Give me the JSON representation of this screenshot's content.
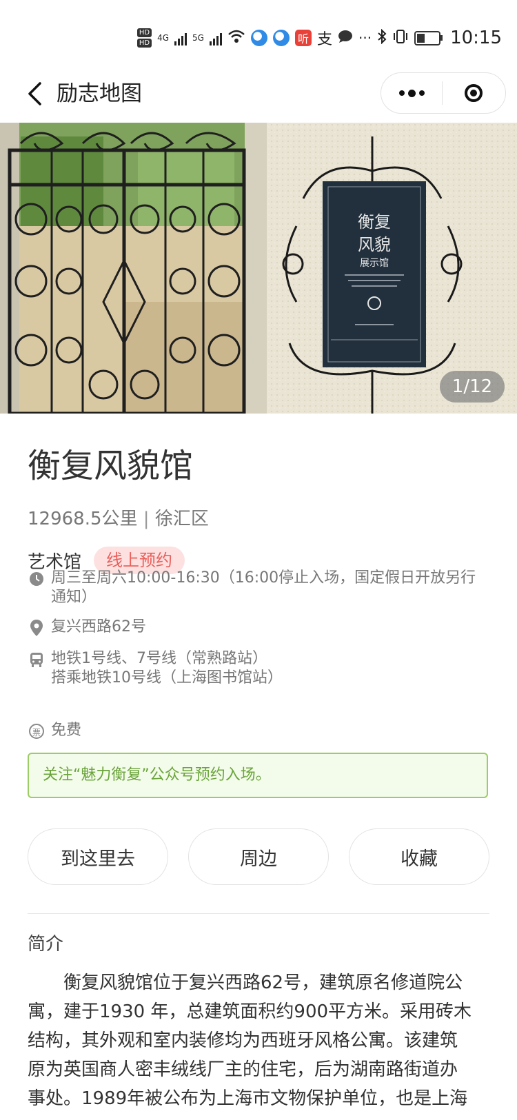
{
  "status_bar": {
    "hd1": "HD",
    "hd2": "HD",
    "net1": "4G",
    "net2": "5G",
    "ting_label": "听",
    "zhi_label": "支",
    "dots": "···",
    "time": "10:15"
  },
  "nav": {
    "title": "励志地图"
  },
  "gallery": {
    "counter": "1/12",
    "sign_line1": "衡复",
    "sign_line2": "风貌",
    "sign_line3": "展示馆"
  },
  "venue": {
    "name": "衡复风貌馆",
    "distance": "12968.5公里",
    "separator": "|",
    "district": "徐汇区",
    "category": "艺术馆",
    "tag": "线上预约",
    "hours_line1": "周三至周六10:00-16:30（16:00停止入场，国定假日开放另行",
    "hours_line2": "通知）",
    "address": "复兴西路62号",
    "transit_line1": "地铁1号线、7号线（常熟路站）",
    "transit_line2": "搭乘地铁10号线（上海图书馆站）",
    "ticket_icon_char": "票",
    "price": "免费",
    "notice": "关注“魅力衡复”公众号预约入场。"
  },
  "actions": {
    "go": "到这里去",
    "nearby": "周边",
    "favorite": "收藏"
  },
  "intro": {
    "heading": "简介",
    "lines": [
      "　　衡复风貌馆位于复兴西路62号，建筑原名修道院公",
      "寓，建于1930 年，总建筑面积约900平方米。采用砖木",
      "结构，其外观和室内装修均为西班牙风格公寓。该建筑",
      "原为英国商人密丰绒线厂主的住宅，后为湖南路街道办",
      "事处。1989年被公布为上海市文物保护单位，也是上海"
    ]
  },
  "colors": {
    "tag_bg": "#fde1e1",
    "tag_text": "#e8605b",
    "notice_border": "#9ccc65",
    "notice_text": "#6aa43a"
  }
}
